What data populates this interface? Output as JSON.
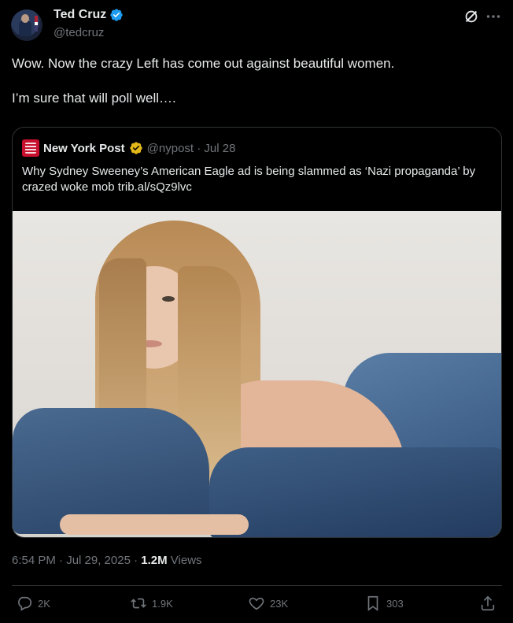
{
  "author": {
    "name": "Ted Cruz",
    "handle": "@tedcruz",
    "avatar_icon": "profile-photo",
    "verified_icon": "verified-badge-icon",
    "verified_color": "#1d9bf0"
  },
  "tweet": {
    "text": "Wow. Now the crazy Left has come out against beautiful women.\n\nI’m sure that will poll well…."
  },
  "quote": {
    "name": "New York Post",
    "handle_date": "@nypost · Jul 28",
    "badge_color": "#e2b719",
    "text": "Why Sydney Sweeney’s American Eagle ad is being slammed as ‘Nazi propaganda’ by crazed woke mob trib.al/sQz9lvc",
    "image_icon": "photo"
  },
  "meta": {
    "timestamp": "6:54 PM · Jul 29, 2025 · ",
    "views_count": "1.2M",
    "views_label": " Views"
  },
  "actions": {
    "replies": "2K",
    "reposts": "1.9K",
    "likes": "23K",
    "bookmarks": "303"
  }
}
